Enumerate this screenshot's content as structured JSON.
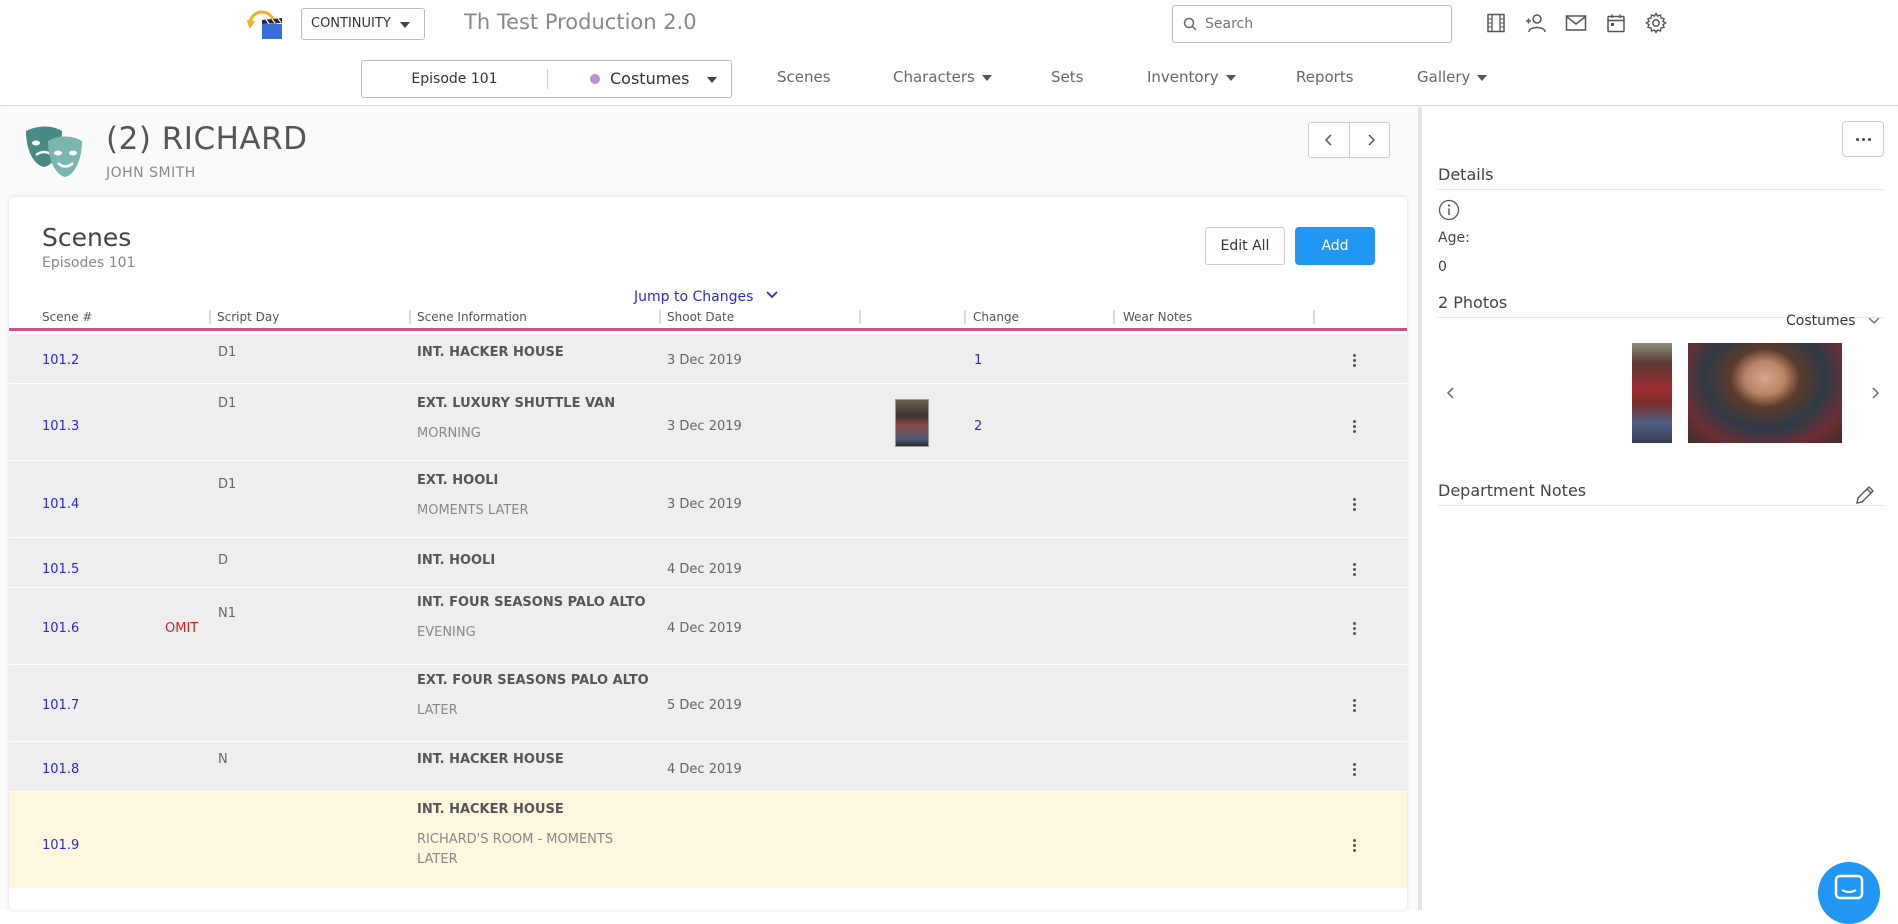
{
  "header": {
    "mode": "CONTINUITY",
    "production_title": "Th Test Production 2.0",
    "search_placeholder": "Search",
    "episode": "Episode 101",
    "department": "Costumes",
    "department_color": "#b98fd8",
    "nav": [
      {
        "label": "Scenes"
      },
      {
        "label": "Characters"
      },
      {
        "label": "Sets"
      },
      {
        "label": "Inventory"
      },
      {
        "label": "Reports"
      },
      {
        "label": "Gallery"
      }
    ],
    "icons": [
      "film-icon",
      "add-user-icon",
      "mail-icon",
      "calendar-icon",
      "gear-icon"
    ]
  },
  "character": {
    "name": "(2) RICHARD",
    "actor": "JOHN SMITH"
  },
  "scenes_card": {
    "title": "Scenes",
    "subtitle": "Episodes 101",
    "edit_all": "Edit All",
    "add": "Add",
    "jump": "Jump to Changes",
    "columns": [
      "Scene #",
      "Script Day",
      "Scene Information",
      "Shoot Date",
      "Change",
      "Wear Notes"
    ],
    "rows": [
      {
        "scene": "101.2",
        "omit": "",
        "day": "D1",
        "info": "INT. HACKER HOUSE",
        "info2": "",
        "date": "3 Dec 2019",
        "change": "1"
      },
      {
        "scene": "101.3",
        "omit": "",
        "day": "D1",
        "info": "EXT. LUXURY SHUTTLE VAN",
        "info2": "MORNING",
        "date": "3 Dec 2019",
        "change": "2"
      },
      {
        "scene": "101.4",
        "omit": "",
        "day": "D1",
        "info": "EXT. HOOLI",
        "info2": "MOMENTS LATER",
        "date": "3 Dec 2019",
        "change": ""
      },
      {
        "scene": "101.5",
        "omit": "",
        "day": "D",
        "info": "INT. HOOLI",
        "info2": "",
        "date": "4 Dec 2019",
        "change": ""
      },
      {
        "scene": "101.6",
        "omit": "OMIT",
        "day": "N1",
        "info": "INT. FOUR SEASONS PALO ALTO",
        "info2": "EVENING",
        "date": "4 Dec 2019",
        "change": ""
      },
      {
        "scene": "101.7",
        "omit": "",
        "day": "",
        "info": "EXT. FOUR SEASONS PALO ALTO",
        "info2": "LATER",
        "date": "5 Dec 2019",
        "change": ""
      },
      {
        "scene": "101.8",
        "omit": "",
        "day": "N",
        "info": "INT. HACKER HOUSE",
        "info2": "",
        "date": "4 Dec 2019",
        "change": ""
      },
      {
        "scene": "101.9",
        "omit": "",
        "day": "",
        "info": "INT. HACKER HOUSE",
        "info2": "RICHARD'S ROOM - MOMENTS",
        "info3": "LATER",
        "date": "",
        "change": ""
      }
    ]
  },
  "right_panel": {
    "details": "Details",
    "age_label": "Age:",
    "age_value": "0",
    "photos_title": "2 Photos",
    "photos_dept": "Costumes",
    "dept_notes": "Department Notes"
  }
}
